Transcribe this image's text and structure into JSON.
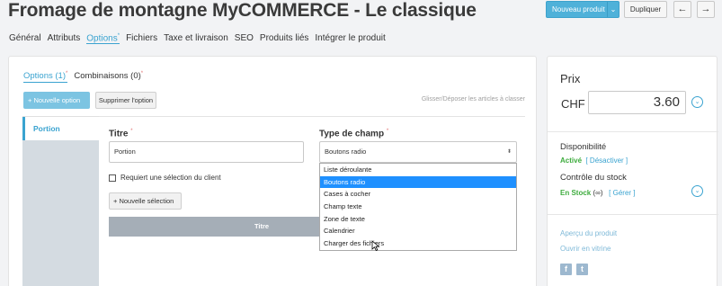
{
  "header": {
    "title": "Fromage de montagne MyCOMMERCE - Le classique",
    "new_product_label": "Nouveau produit",
    "duplicate_label": "Dupliquer",
    "prev_arrow": "←",
    "next_arrow": "→",
    "split_arrow": "⌄"
  },
  "tabs": {
    "general": "Général",
    "attributes": "Attributs",
    "options": "Options",
    "options_mark": "*",
    "files": "Fichiers",
    "tax": "Taxe et livraison",
    "seo": "SEO",
    "related": "Produits liés",
    "integrate": "Intégrer le produit"
  },
  "subtabs": {
    "options": "Options (1)",
    "combinations": "Combinaisons (0)",
    "mark": "*"
  },
  "toolbar": {
    "new_option": "+ Nouvelle option",
    "delete_option": "Supprimer l'option",
    "drag_hint": "Glisser/Déposer les articles à classer"
  },
  "option_list": {
    "items": [
      "Portion"
    ]
  },
  "form": {
    "title_label": "Titre",
    "required_mark": "*",
    "title_value": "Portion",
    "type_label": "Type de champ",
    "type_value": "Boutons radio",
    "required_checkbox_label": "Requiert une sélection du client",
    "new_selection_label": "+ Nouvelle sélection",
    "table_header_title": "Titre",
    "select_caret": "⬍"
  },
  "dropdown": {
    "options": [
      "Liste déroulante",
      "Boutons radio",
      "Cases à cocher",
      "Champ texte",
      "Zone de texte",
      "Calendrier",
      "Charger des fichiers"
    ],
    "highlighted": "Boutons radio"
  },
  "sidebar": {
    "price_label": "Prix",
    "currency": "CHF",
    "price_value": "3.60",
    "availability_label": "Disponibilité",
    "availability_status": "Activé",
    "deactivate_link": "[ Désactiver ]",
    "stock_label": "Contrôle du stock",
    "stock_status": "En Stock",
    "stock_infinity": "(∞)",
    "manage_link": "[ Gérer ]",
    "preview_link": "Aperçu du produit",
    "open_shop_link": "Ouvrir en vitrine",
    "facebook_glyph": "f",
    "twitter_glyph": "t",
    "chevron": "⌄"
  }
}
